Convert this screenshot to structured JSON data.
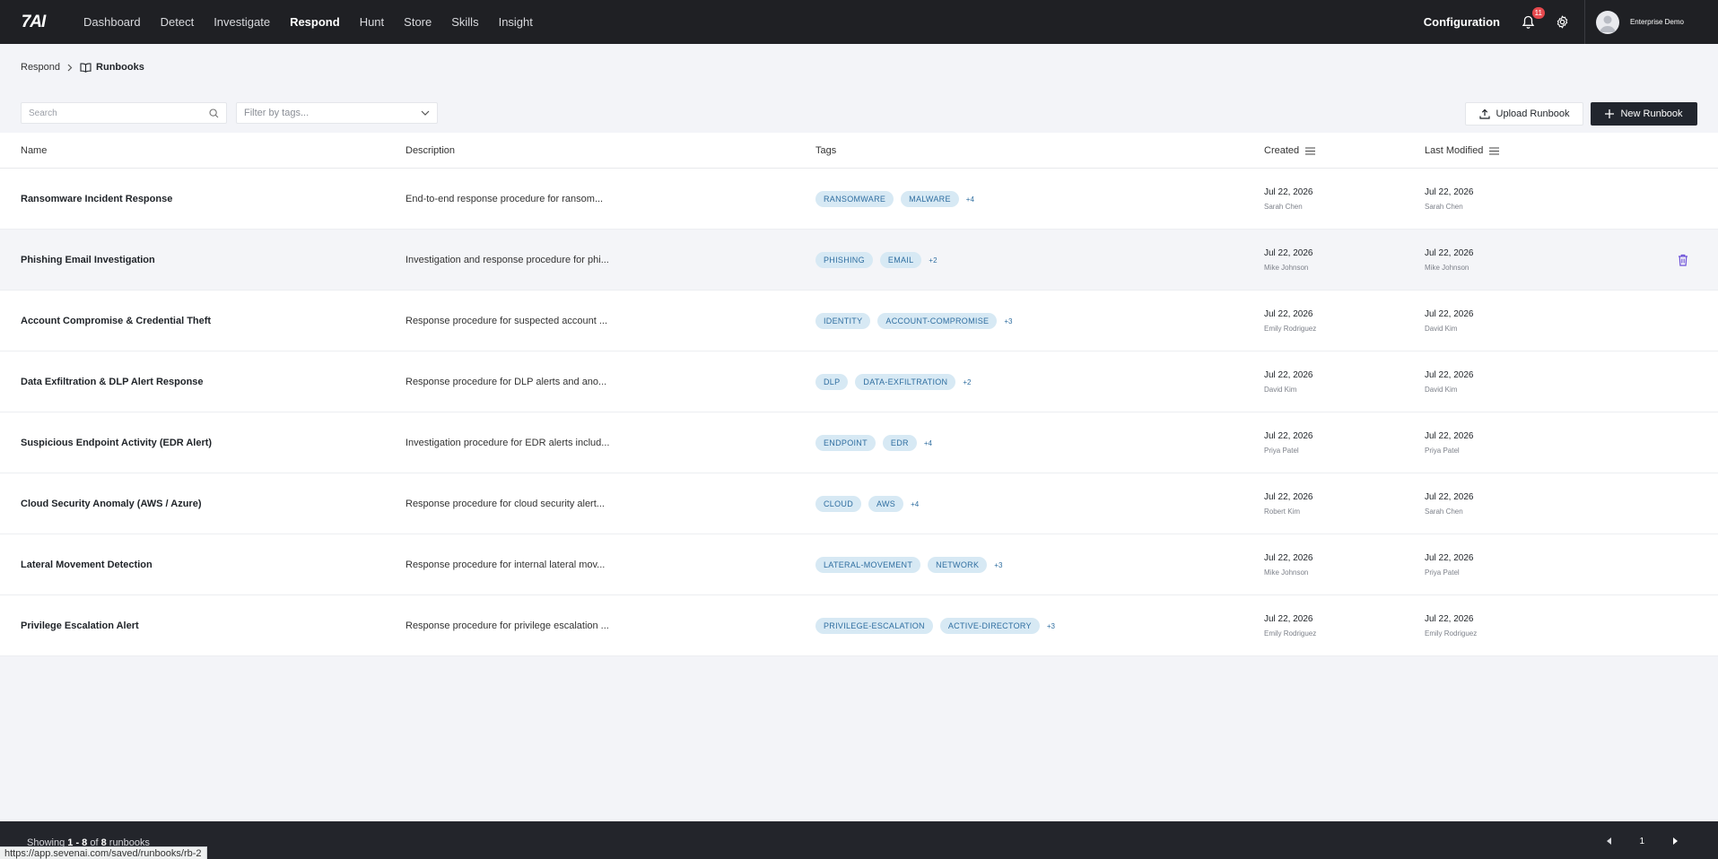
{
  "app": {
    "logo_text": "7AI"
  },
  "nav": {
    "items": [
      {
        "label": "Dashboard"
      },
      {
        "label": "Detect"
      },
      {
        "label": "Investigate"
      },
      {
        "label": "Respond"
      },
      {
        "label": "Hunt"
      },
      {
        "label": "Store"
      },
      {
        "label": "Skills"
      },
      {
        "label": "Insight"
      }
    ],
    "active": "Respond",
    "configuration_label": "Configuration",
    "notification_count": "11",
    "user_name": "Enterprise Demo"
  },
  "breadcrumb": {
    "parent": "Respond",
    "current": "Runbooks"
  },
  "toolbar": {
    "search_placeholder": "Search",
    "filter_placeholder": "Filter by tags...",
    "upload_label": "Upload Runbook",
    "new_label": "New Runbook"
  },
  "table": {
    "headers": {
      "name": "Name",
      "description": "Description",
      "tags": "Tags",
      "created": "Created",
      "modified": "Last Modified"
    },
    "rows": [
      {
        "name": "Ransomware Incident Response",
        "description": "End-to-end response procedure for ransom...",
        "tags": [
          "RANSOMWARE",
          "MALWARE"
        ],
        "more": "+4",
        "created": "Jul 22, 2026",
        "created_by": "Sarah Chen",
        "modified": "Jul 22, 2026",
        "modified_by": "Sarah Chen"
      },
      {
        "name": "Phishing Email Investigation",
        "description": "Investigation and response procedure for phi...",
        "tags": [
          "PHISHING",
          "EMAIL"
        ],
        "more": "+2",
        "created": "Jul 22, 2026",
        "created_by": "Mike Johnson",
        "modified": "Jul 22, 2026",
        "modified_by": "Mike Johnson"
      },
      {
        "name": "Account Compromise & Credential Theft",
        "description": "Response procedure for suspected account ...",
        "tags": [
          "IDENTITY",
          "ACCOUNT-COMPROMISE"
        ],
        "more": "+3",
        "created": "Jul 22, 2026",
        "created_by": "Emily Rodriguez",
        "modified": "Jul 22, 2026",
        "modified_by": "David Kim"
      },
      {
        "name": "Data Exfiltration & DLP Alert Response",
        "description": "Response procedure for DLP alerts and ano...",
        "tags": [
          "DLP",
          "DATA-EXFILTRATION"
        ],
        "more": "+2",
        "created": "Jul 22, 2026",
        "created_by": "David Kim",
        "modified": "Jul 22, 2026",
        "modified_by": "David Kim"
      },
      {
        "name": "Suspicious Endpoint Activity (EDR Alert)",
        "description": "Investigation procedure for EDR alerts includ...",
        "tags": [
          "ENDPOINT",
          "EDR"
        ],
        "more": "+4",
        "created": "Jul 22, 2026",
        "created_by": "Priya Patel",
        "modified": "Jul 22, 2026",
        "modified_by": "Priya Patel"
      },
      {
        "name": "Cloud Security Anomaly (AWS / Azure)",
        "description": "Response procedure for cloud security alert...",
        "tags": [
          "CLOUD",
          "AWS"
        ],
        "more": "+4",
        "created": "Jul 22, 2026",
        "created_by": "Robert Kim",
        "modified": "Jul 22, 2026",
        "modified_by": "Sarah Chen"
      },
      {
        "name": "Lateral Movement Detection",
        "description": "Response procedure for internal lateral mov...",
        "tags": [
          "LATERAL-MOVEMENT",
          "NETWORK"
        ],
        "more": "+3",
        "created": "Jul 22, 2026",
        "created_by": "Mike Johnson",
        "modified": "Jul 22, 2026",
        "modified_by": "Priya Patel"
      },
      {
        "name": "Privilege Escalation Alert",
        "description": "Response procedure for privilege escalation ...",
        "tags": [
          "PRIVILEGE-ESCALATION",
          "ACTIVE-DIRECTORY"
        ],
        "more": "+3",
        "created": "Jul 22, 2026",
        "created_by": "Emily Rodriguez",
        "modified": "Jul 22, 2026",
        "modified_by": "Emily Rodriguez"
      }
    ],
    "hovered_row": 1
  },
  "footer": {
    "showing_prefix": "Showing",
    "range": "1 - 8",
    "of": "of",
    "total": "8",
    "suffix": "runbooks",
    "page": "1"
  },
  "status_url": "https://app.sevenai.com/saved/runbooks/rb-2",
  "colors": {
    "nav_bg": "#1f2024",
    "tag_bg": "#d7e9f4",
    "tag_text": "#2f6ea0",
    "badge": "#e5484d",
    "trash": "#6b4fd8"
  }
}
